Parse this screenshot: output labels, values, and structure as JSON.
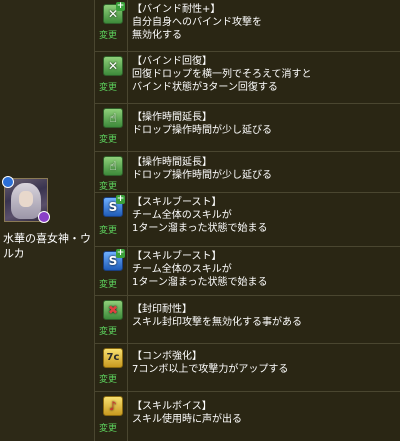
{
  "character": {
    "name": "水華の喜女神・ウルカ",
    "main_attribute_color": "#2c6fd6",
    "sub_attribute_color": "#8a3fc8"
  },
  "change_label": "変更",
  "awakenings": [
    {
      "icon": "bind-resist-icon",
      "title": "【バインド耐性+】",
      "desc": [
        "自分自身へのバインド攻撃を",
        "無効化する"
      ]
    },
    {
      "icon": "bind-recovery-icon",
      "title": "【バインド回復】",
      "desc": [
        "回復ドロップを横一列でそろえて消すと",
        "バインド状態が3ターン回復する"
      ]
    },
    {
      "icon": "time-extend-icon",
      "title": "【操作時間延長】",
      "desc": [
        "ドロップ操作時間が少し延びる"
      ]
    },
    {
      "icon": "time-extend-icon",
      "title": "【操作時間延長】",
      "desc": [
        "ドロップ操作時間が少し延びる"
      ]
    },
    {
      "icon": "skill-boost-icon",
      "title": "【スキルブースト】",
      "desc": [
        "チーム全体のスキルが",
        "1ターン溜まった状態で始まる"
      ]
    },
    {
      "icon": "skill-boost-icon",
      "title": "【スキルブースト】",
      "desc": [
        "チーム全体のスキルが",
        "1ターン溜まった状態で始まる"
      ]
    },
    {
      "icon": "seal-resist-icon",
      "title": "【封印耐性】",
      "desc": [
        "スキル封印攻撃を無効化する事がある"
      ]
    },
    {
      "icon": "combo-boost-icon",
      "title": "【コンボ強化】",
      "desc": [
        "7コンボ以上で攻撃力がアップする"
      ]
    },
    {
      "icon": "skill-voice-icon",
      "title": "【スキルボイス】",
      "desc": [
        "スキル使用時に声が出る"
      ]
    }
  ]
}
